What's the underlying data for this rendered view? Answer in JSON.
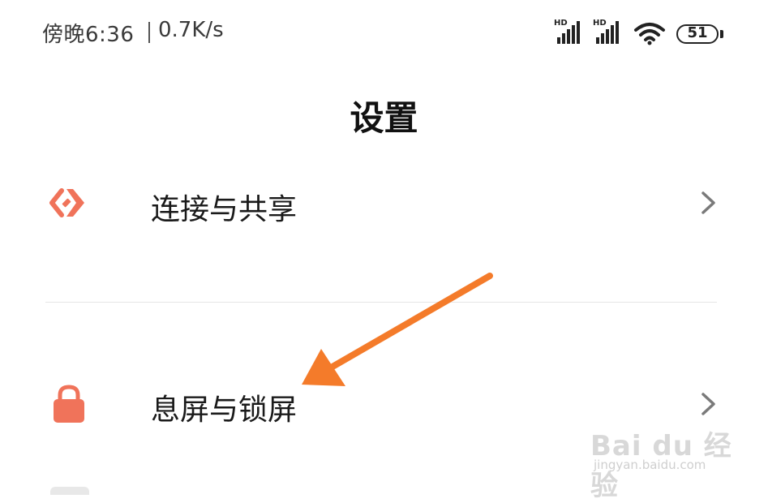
{
  "status_bar": {
    "time": "傍晚6:36",
    "speed": "0.7K/s",
    "signal1_label": "HD",
    "signal2_label": "HD",
    "battery": "51"
  },
  "page": {
    "title": "设置"
  },
  "settings": [
    {
      "label": "连接与共享",
      "icon": "share-connection-icon",
      "color": "#f0735a"
    },
    {
      "label": "息屏与锁屏",
      "icon": "lock-icon",
      "color": "#f0735a"
    }
  ],
  "annotation": {
    "arrow_color": "#f47b2a"
  },
  "watermark": {
    "brand": "Bai du 经验",
    "url": "jingyan.baidu.com"
  }
}
